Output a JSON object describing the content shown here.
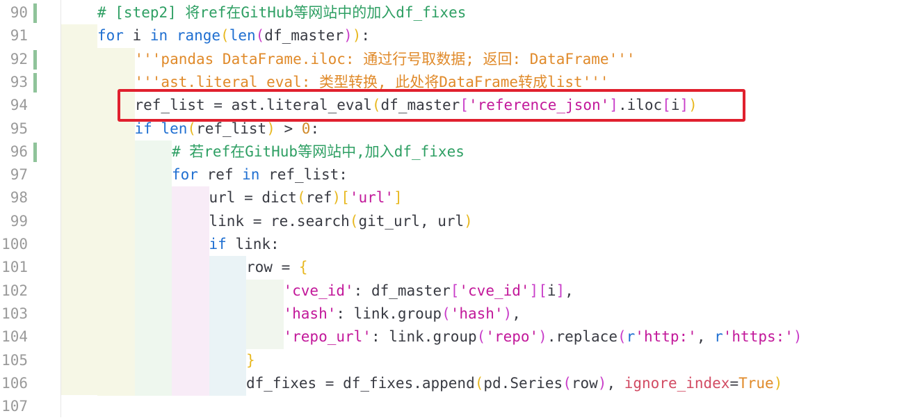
{
  "colors": {
    "keyword": "#1f6fd1",
    "comment": "#2e9f63",
    "string_doc": "#e08a2a",
    "string": "#c2189a",
    "identifier": "#383a42",
    "number": "#d08a2a",
    "bracket_yellow": "#e8b820",
    "bracket_magenta": "#c93ec9",
    "kwarg": "#d24b63",
    "constant": "#e08a2a",
    "line_number": "#9a9a9a",
    "highlight_box": "#e0202e",
    "change_marker": "#8fc39a"
  },
  "gutter": {
    "line_numbers": [
      "90",
      "91",
      "92",
      "93",
      "94",
      "95",
      "96",
      "97",
      "98",
      "99",
      "100",
      "101",
      "102",
      "103",
      "104",
      "105",
      "106",
      "107"
    ],
    "changed_lines": [
      "90",
      "92",
      "93",
      "96"
    ]
  },
  "highlighted_line": "94",
  "code": [
    {
      "num": "90",
      "indent": 0,
      "tokens": [
        {
          "t": "# [step2] 将ref在GitHub等网站中的加入df_fixes",
          "c": "comment"
        }
      ]
    },
    {
      "num": "91",
      "indent": 0,
      "tokens": [
        {
          "t": "for",
          "c": "keyword"
        },
        {
          "t": " i ",
          "c": "identifier"
        },
        {
          "t": "in",
          "c": "keyword"
        },
        {
          "t": " ",
          "c": "identifier"
        },
        {
          "t": "range",
          "c": "keyword"
        },
        {
          "t": "(",
          "c": "bracket_yellow"
        },
        {
          "t": "len",
          "c": "keyword"
        },
        {
          "t": "(",
          "c": "bracket_magenta"
        },
        {
          "t": "df_master",
          "c": "identifier"
        },
        {
          "t": ")",
          "c": "bracket_magenta"
        },
        {
          "t": ")",
          "c": "bracket_yellow"
        },
        {
          "t": ":",
          "c": "identifier"
        }
      ]
    },
    {
      "num": "92",
      "indent": 1,
      "tokens": [
        {
          "t": "'''pandas DataFrame.iloc: 通过行号取数据; 返回: DataFrame'''",
          "c": "string_doc"
        }
      ]
    },
    {
      "num": "93",
      "indent": 1,
      "tokens": [
        {
          "t": "'''ast.literal_eval: 类型转换, 此处将DataFrame转成list'''",
          "c": "string_doc"
        }
      ]
    },
    {
      "num": "94",
      "indent": 1,
      "tokens": [
        {
          "t": "ref_list = ast.literal_eval",
          "c": "identifier"
        },
        {
          "t": "(",
          "c": "bracket_yellow"
        },
        {
          "t": "df_master",
          "c": "identifier"
        },
        {
          "t": "[",
          "c": "bracket_magenta"
        },
        {
          "t": "'reference_json'",
          "c": "string"
        },
        {
          "t": "]",
          "c": "bracket_magenta"
        },
        {
          "t": ".iloc",
          "c": "identifier"
        },
        {
          "t": "[",
          "c": "bracket_magenta"
        },
        {
          "t": "i",
          "c": "identifier"
        },
        {
          "t": "]",
          "c": "bracket_magenta"
        },
        {
          "t": ")",
          "c": "bracket_yellow"
        }
      ]
    },
    {
      "num": "95",
      "indent": 1,
      "tokens": [
        {
          "t": "if",
          "c": "keyword"
        },
        {
          "t": " ",
          "c": "identifier"
        },
        {
          "t": "len",
          "c": "keyword"
        },
        {
          "t": "(",
          "c": "bracket_yellow"
        },
        {
          "t": "ref_list",
          "c": "identifier"
        },
        {
          "t": ")",
          "c": "bracket_yellow"
        },
        {
          "t": " > ",
          "c": "identifier"
        },
        {
          "t": "0",
          "c": "number"
        },
        {
          "t": ":",
          "c": "identifier"
        }
      ]
    },
    {
      "num": "96",
      "indent": 2,
      "tokens": [
        {
          "t": "# 若ref在GitHub等网站中,加入df_fixes",
          "c": "comment"
        }
      ]
    },
    {
      "num": "97",
      "indent": 2,
      "tokens": [
        {
          "t": "for",
          "c": "keyword"
        },
        {
          "t": " ref ",
          "c": "identifier"
        },
        {
          "t": "in",
          "c": "keyword"
        },
        {
          "t": " ref_list:",
          "c": "identifier"
        }
      ]
    },
    {
      "num": "98",
      "indent": 3,
      "tokens": [
        {
          "t": "url = dict",
          "c": "identifier"
        },
        {
          "t": "(",
          "c": "bracket_yellow"
        },
        {
          "t": "ref",
          "c": "identifier"
        },
        {
          "t": ")",
          "c": "bracket_yellow"
        },
        {
          "t": "[",
          "c": "bracket_yellow"
        },
        {
          "t": "'url'",
          "c": "string"
        },
        {
          "t": "]",
          "c": "bracket_yellow"
        }
      ]
    },
    {
      "num": "99",
      "indent": 3,
      "tokens": [
        {
          "t": "link = re.search",
          "c": "identifier"
        },
        {
          "t": "(",
          "c": "bracket_yellow"
        },
        {
          "t": "git_url, url",
          "c": "identifier"
        },
        {
          "t": ")",
          "c": "bracket_yellow"
        }
      ]
    },
    {
      "num": "100",
      "indent": 3,
      "tokens": [
        {
          "t": "if",
          "c": "keyword"
        },
        {
          "t": " link:",
          "c": "identifier"
        }
      ]
    },
    {
      "num": "101",
      "indent": 4,
      "tokens": [
        {
          "t": "row = ",
          "c": "identifier"
        },
        {
          "t": "{",
          "c": "bracket_yellow"
        }
      ]
    },
    {
      "num": "102",
      "indent": 5,
      "tokens": [
        {
          "t": "'cve_id'",
          "c": "string"
        },
        {
          "t": ": df_master",
          "c": "identifier"
        },
        {
          "t": "[",
          "c": "bracket_magenta"
        },
        {
          "t": "'cve_id'",
          "c": "string"
        },
        {
          "t": "]",
          "c": "bracket_magenta"
        },
        {
          "t": "[",
          "c": "bracket_magenta"
        },
        {
          "t": "i",
          "c": "identifier"
        },
        {
          "t": "]",
          "c": "bracket_magenta"
        },
        {
          "t": ",",
          "c": "identifier"
        }
      ]
    },
    {
      "num": "103",
      "indent": 5,
      "tokens": [
        {
          "t": "'hash'",
          "c": "string"
        },
        {
          "t": ": link.group",
          "c": "identifier"
        },
        {
          "t": "(",
          "c": "bracket_magenta"
        },
        {
          "t": "'hash'",
          "c": "string"
        },
        {
          "t": ")",
          "c": "bracket_magenta"
        },
        {
          "t": ",",
          "c": "identifier"
        }
      ]
    },
    {
      "num": "104",
      "indent": 5,
      "tokens": [
        {
          "t": "'repo_url'",
          "c": "string"
        },
        {
          "t": ": link.group",
          "c": "identifier"
        },
        {
          "t": "(",
          "c": "bracket_magenta"
        },
        {
          "t": "'repo'",
          "c": "string"
        },
        {
          "t": ")",
          "c": "bracket_magenta"
        },
        {
          "t": ".replace",
          "c": "identifier"
        },
        {
          "t": "(",
          "c": "bracket_magenta"
        },
        {
          "t": "r",
          "c": "keyword"
        },
        {
          "t": "'http:'",
          "c": "string"
        },
        {
          "t": ", ",
          "c": "identifier"
        },
        {
          "t": "r",
          "c": "keyword"
        },
        {
          "t": "'https:'",
          "c": "string"
        },
        {
          "t": ")",
          "c": "bracket_magenta"
        }
      ]
    },
    {
      "num": "105",
      "indent": 4,
      "tokens": [
        {
          "t": "}",
          "c": "bracket_yellow"
        }
      ]
    },
    {
      "num": "106",
      "indent": 4,
      "tokens": [
        {
          "t": "df_fixes = df_fixes.append",
          "c": "identifier"
        },
        {
          "t": "(",
          "c": "bracket_yellow"
        },
        {
          "t": "pd.Series",
          "c": "identifier"
        },
        {
          "t": "(",
          "c": "bracket_magenta"
        },
        {
          "t": "row",
          "c": "identifier"
        },
        {
          "t": ")",
          "c": "bracket_magenta"
        },
        {
          "t": ", ",
          "c": "identifier"
        },
        {
          "t": "ignore_index",
          "c": "kwarg"
        },
        {
          "t": "=",
          "c": "identifier"
        },
        {
          "t": "True",
          "c": "constant"
        },
        {
          "t": ")",
          "c": "bracket_yellow"
        }
      ]
    },
    {
      "num": "107",
      "indent": 0,
      "tokens": []
    }
  ]
}
